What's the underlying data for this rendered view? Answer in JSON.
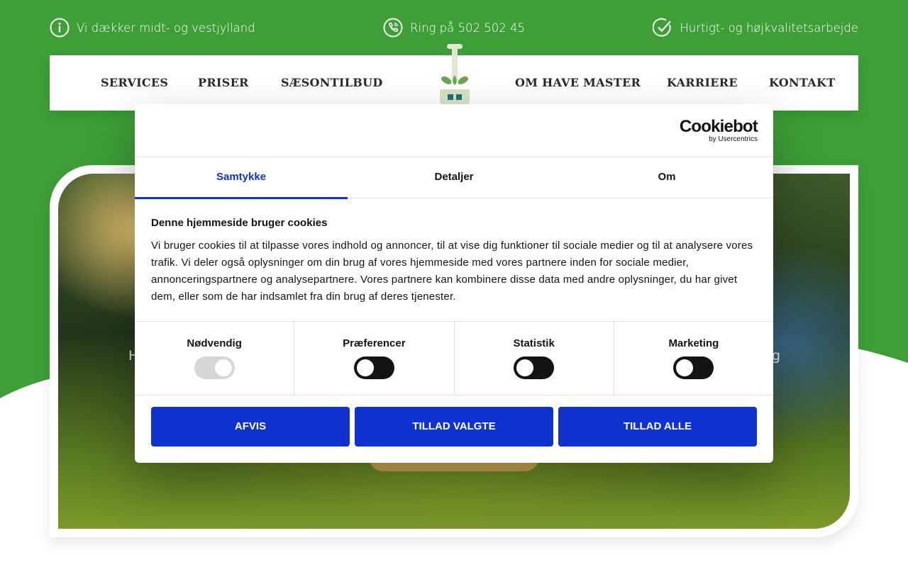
{
  "colors": {
    "brand_green": "#3e9f37",
    "cookie_blue": "#1032cf",
    "hero_button_gold": "#c9a656"
  },
  "topbar": {
    "coverage": {
      "icon": "info-icon",
      "text": "Vi dækker midt- og vestjylland"
    },
    "phone": {
      "icon": "phone-icon",
      "text": "Ring på 502 502 45"
    },
    "quality": {
      "icon": "check-circle-icon",
      "text": "Hurtigt- og højkvalitetsarbejde"
    }
  },
  "nav": {
    "left": [
      "SERVICES",
      "PRISER",
      "SÆSONTILBUD"
    ],
    "right": [
      "OM HAVE MASTER",
      "KARRIERE",
      "KONTAKT"
    ],
    "logo": "shovel-logo"
  },
  "hero": {
    "text_left_fragment": "H",
    "text_right_fragment": "g"
  },
  "cookie": {
    "brand": {
      "name": "Cookiebot",
      "by": "by Usercentrics"
    },
    "tabs": [
      "Samtykke",
      "Detaljer",
      "Om"
    ],
    "active_tab": "Samtykke",
    "heading": "Denne hjemmeside bruger cookies",
    "body": "Vi bruger cookies til at tilpasse vores indhold og annoncer, til at vise dig funktioner til sociale medier og til at analysere vores trafik. Vi deler også oplysninger om din brug af vores hjemmeside med vores partnere inden for sociale medier, annonceringspartnere og analysepartnere. Vores partnere kan kombinere disse data med andre oplysninger, du har givet dem, eller som de har indsamlet fra din brug af deres tjenester.",
    "toggles": [
      {
        "label": "Nødvendig",
        "state": "on-disabled"
      },
      {
        "label": "Præferencer",
        "state": "off"
      },
      {
        "label": "Statistik",
        "state": "off"
      },
      {
        "label": "Marketing",
        "state": "off"
      }
    ],
    "buttons": {
      "reject": "AFVIS",
      "allow_selected": "TILLAD VALGTE",
      "allow_all": "TILLAD ALLE"
    }
  }
}
